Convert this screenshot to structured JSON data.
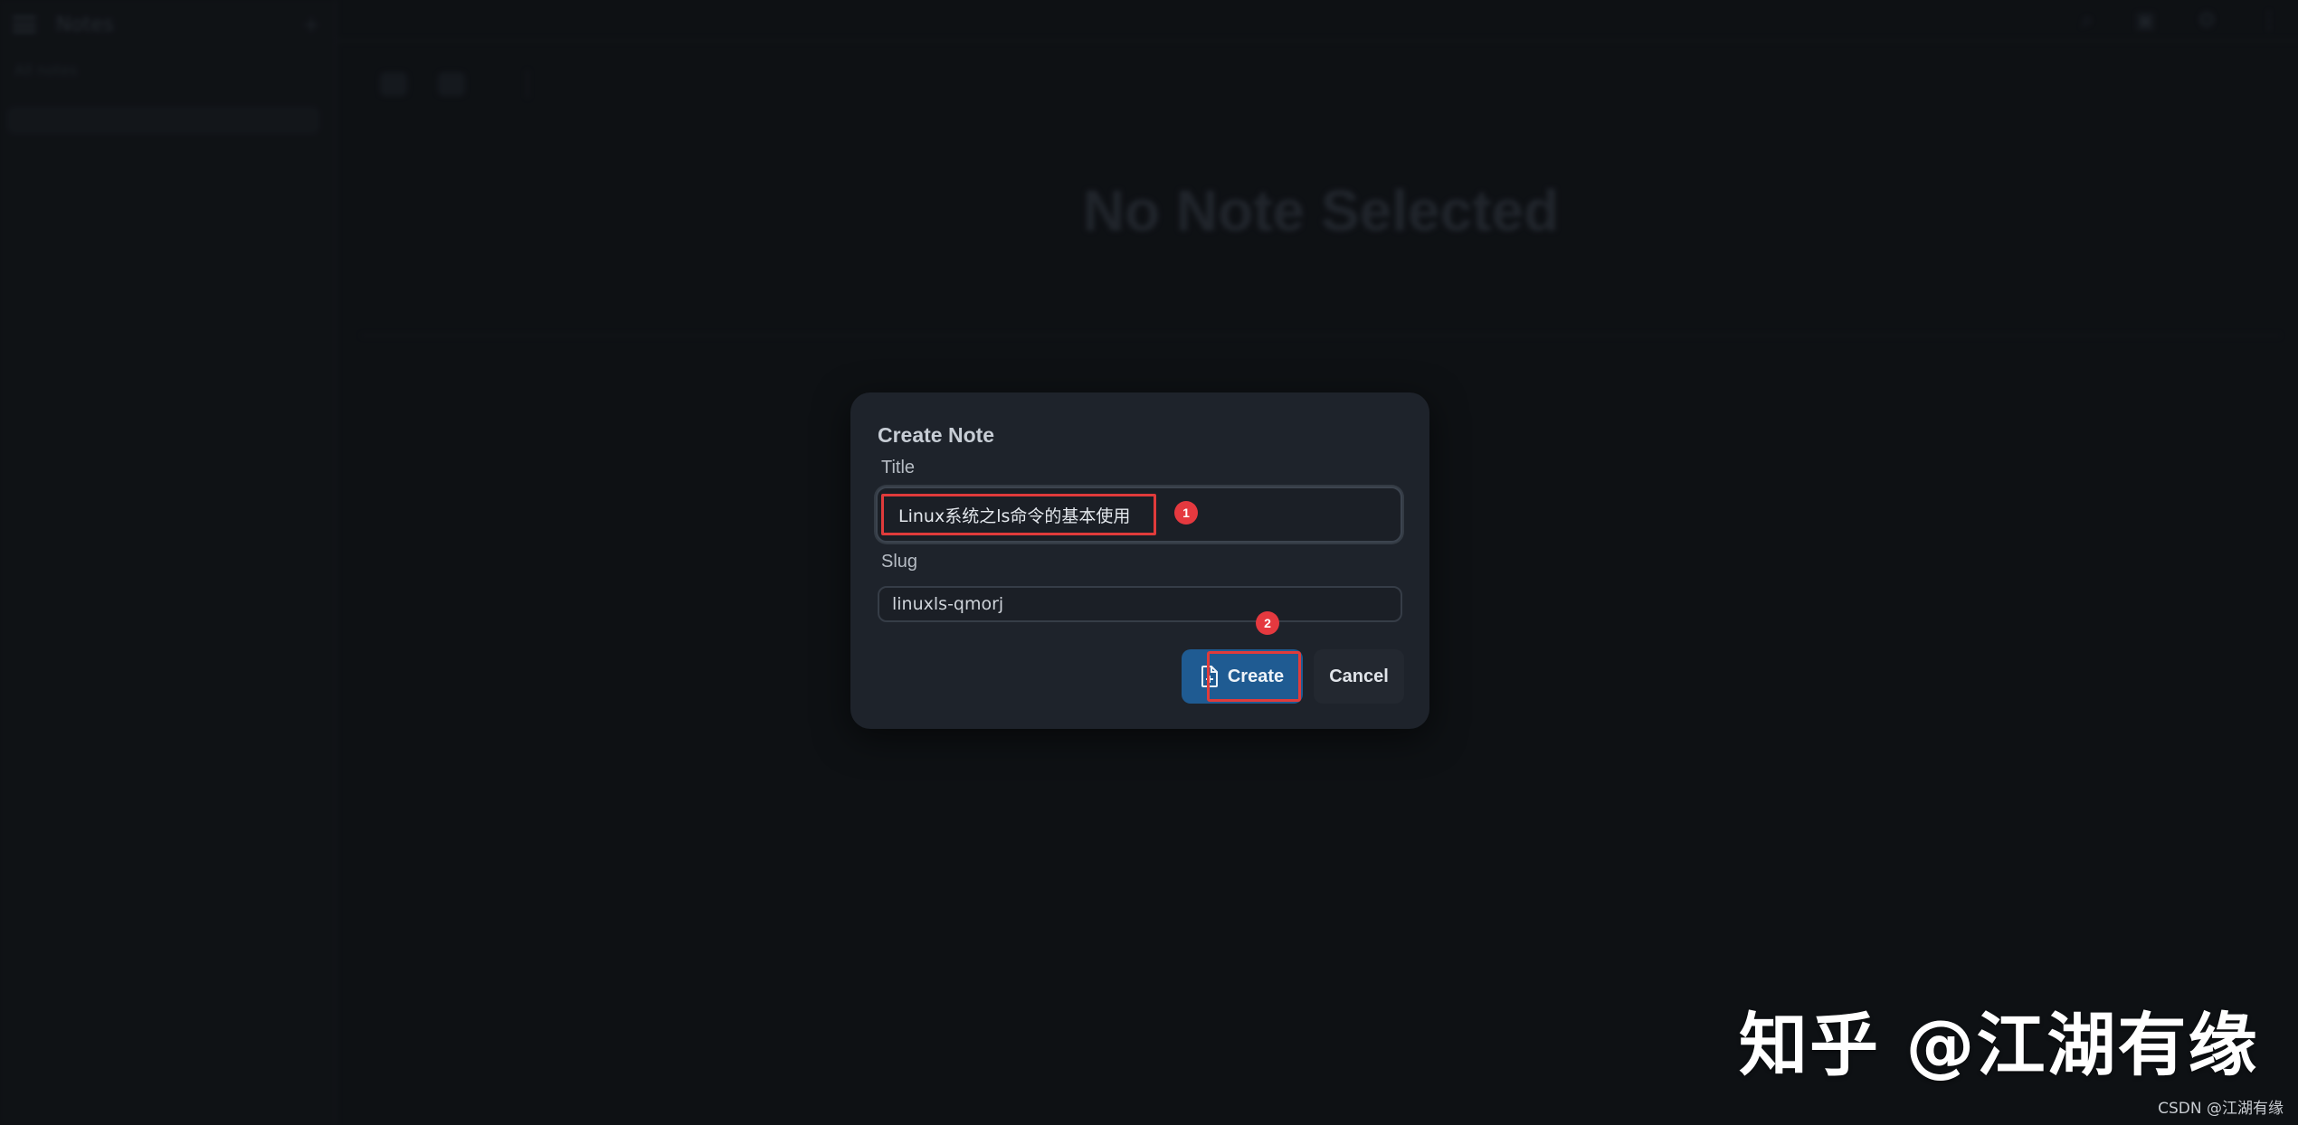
{
  "background": {
    "sidebar": {
      "title": "Notes",
      "new_icon": "+",
      "section_label": "All notes",
      "row_label": "",
      "footer_lines": [
        "",
        ""
      ]
    },
    "topbar": {
      "title": "",
      "icons": [
        "search-icon",
        "layout-icon",
        "settings-icon",
        "menu-icon"
      ]
    },
    "toolbar": {
      "items": [
        "",
        "",
        ""
      ]
    },
    "empty_state": {
      "title": "No Note Selected",
      "subtitle": ""
    }
  },
  "modal": {
    "title": "Create Note",
    "title_label": "Title",
    "title_value": "Linux系统之ls命令的基本使用",
    "slug_label": "Slug",
    "slug_value": "linuxls-qmorj",
    "create_label": "Create",
    "cancel_label": "Cancel",
    "badge_1": "1",
    "badge_2": "2",
    "accent_color": "#1f5b92",
    "highlight_color": "#e03b3b"
  },
  "watermark": {
    "main": "知乎 @江湖有缘",
    "corner": "CSDN @江湖有缘"
  }
}
